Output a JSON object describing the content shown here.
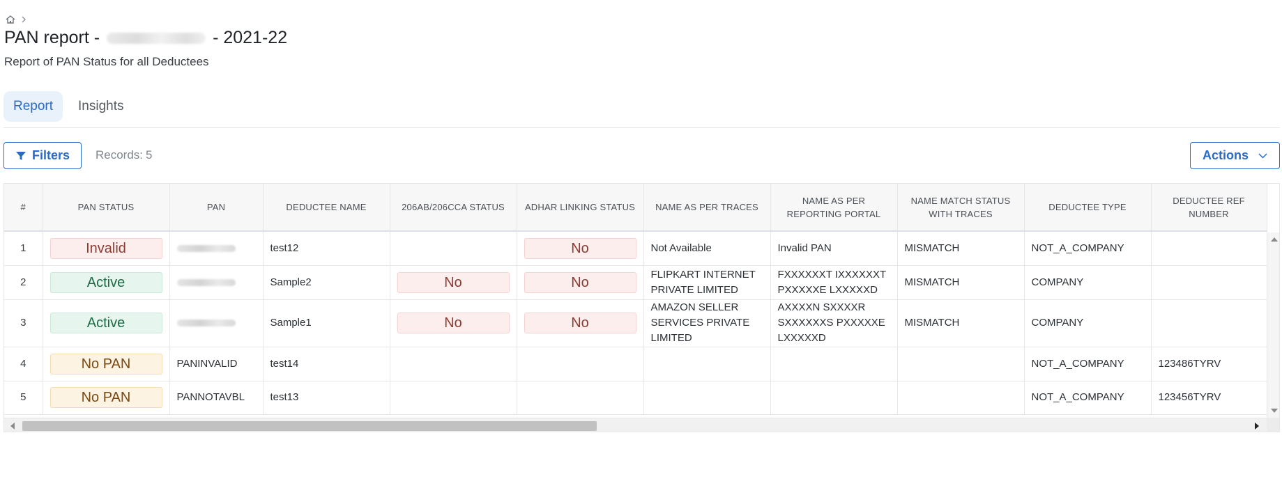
{
  "header": {
    "title_prefix": "PAN report -",
    "title_suffix": "- 2021-22",
    "subtitle": "Report of PAN Status for all Deductees"
  },
  "tabs": [
    {
      "label": "Report",
      "active": true
    },
    {
      "label": "Insights",
      "active": false
    }
  ],
  "toolbar": {
    "filters_label": "Filters",
    "records_label": "Records:",
    "records_count": "5",
    "actions_label": "Actions"
  },
  "colors": {
    "accent": "#2a6ac9",
    "invalid": "#8c3b33",
    "active": "#1d6b45",
    "nopan": "#7b4a12"
  },
  "table": {
    "columns": [
      "#",
      "PAN STATUS",
      "PAN",
      "DEDUCTEE NAME",
      "206AB/206CCA STATUS",
      "ADHAR LINKING STATUS",
      "NAME AS PER TRACES",
      "NAME AS PER REPORTING PORTAL",
      "NAME MATCH STATUS WITH TRACES",
      "DEDUCTEE TYPE",
      "DEDUCTEE REF NUMBER"
    ],
    "rows": [
      {
        "index": "1",
        "pan_status": "Invalid",
        "pan": "",
        "deductee_name": "test12",
        "ab_status": "",
        "adhar_status": "No",
        "name_traces": "Not Available",
        "name_portal": "Invalid PAN",
        "match_status": "MISMATCH",
        "deductee_type": "NOT_A_COMPANY",
        "ref_number": ""
      },
      {
        "index": "2",
        "pan_status": "Active",
        "pan": "",
        "deductee_name": "Sample2",
        "ab_status": "No",
        "adhar_status": "No",
        "name_traces": "FLIPKART INTERNET PRIVATE LIMITED",
        "name_portal": "FXXXXXXT IXXXXXXT PXXXXXE LXXXXXD",
        "match_status": "MISMATCH",
        "deductee_type": "COMPANY",
        "ref_number": ""
      },
      {
        "index": "3",
        "pan_status": "Active",
        "pan": "",
        "deductee_name": "Sample1",
        "ab_status": "No",
        "adhar_status": "No",
        "name_traces": "AMAZON SELLER SERVICES PRIVATE LIMITED",
        "name_portal": "AXXXXN SXXXXR SXXXXXXS PXXXXXE LXXXXXD",
        "match_status": "MISMATCH",
        "deductee_type": "COMPANY",
        "ref_number": ""
      },
      {
        "index": "4",
        "pan_status": "No PAN",
        "pan": "PANINVALID",
        "deductee_name": "test14",
        "ab_status": "",
        "adhar_status": "",
        "name_traces": "",
        "name_portal": "",
        "match_status": "",
        "deductee_type": "NOT_A_COMPANY",
        "ref_number": "123486TYRV"
      },
      {
        "index": "5",
        "pan_status": "No PAN",
        "pan": "PANNOTAVBL",
        "deductee_name": "test13",
        "ab_status": "",
        "adhar_status": "",
        "name_traces": "",
        "name_portal": "",
        "match_status": "",
        "deductee_type": "NOT_A_COMPANY",
        "ref_number": "123456TYRV"
      }
    ]
  },
  "icons": {
    "breadcrumb_home": "home-icon",
    "breadcrumb_sep": "chevron-right-icon",
    "filters": "filter-icon",
    "actions": "chevron-down-icon"
  }
}
